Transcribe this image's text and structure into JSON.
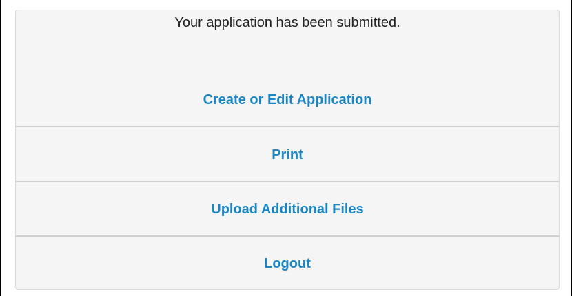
{
  "panel": {
    "message": "Your application has been submitted.",
    "menu": [
      {
        "label": "Create or Edit Application"
      },
      {
        "label": "Print"
      },
      {
        "label": "Upload Additional Files"
      },
      {
        "label": "Logout"
      }
    ]
  },
  "colors": {
    "link": "#1a86c4",
    "panel_background": "#f5f5f5",
    "divider": "#cfcfcf",
    "text": "#222222"
  }
}
